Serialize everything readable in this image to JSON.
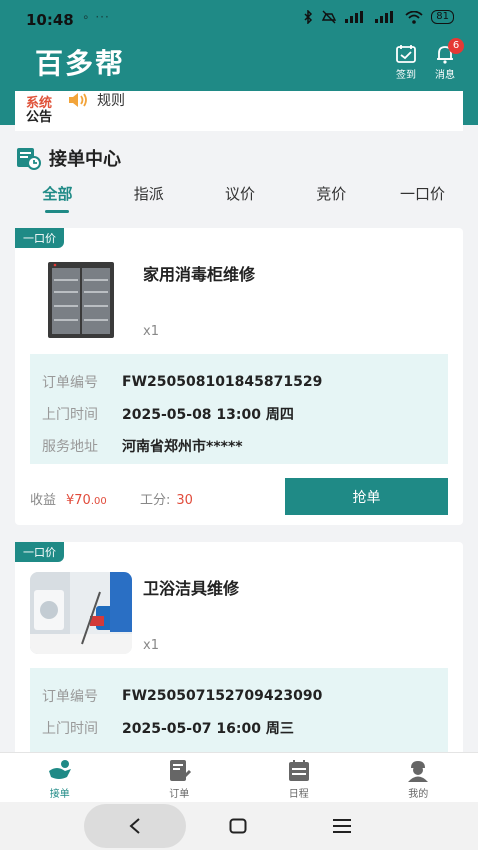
{
  "status_bar": {
    "time": "10:48",
    "extras": "∘ ···",
    "battery": "81"
  },
  "header": {
    "brand": "百多帮",
    "signin_label": "签到",
    "message_label": "消息",
    "message_badge": "6"
  },
  "notice": {
    "label_top": "系统",
    "label_bottom": "公告",
    "text": "规则"
  },
  "section": {
    "title": "接单中心"
  },
  "tabs": [
    "全部",
    "指派",
    "议价",
    "竞价",
    "一口价"
  ],
  "orders": [
    {
      "tag": "一口价",
      "title": "家用消毒柜维修",
      "qty": "x1",
      "order_no_label": "订单编号",
      "order_no": "FW250508101845871529",
      "time_label": "上门时间",
      "time": "2025-05-08 13:00 周四",
      "addr_label": "服务地址",
      "addr": "河南省郑州市*****",
      "earn_label": "收益",
      "earn_amount": "¥70",
      "earn_cents": ".00",
      "points_label": "工分:",
      "points": "30",
      "button": "抢单"
    },
    {
      "tag": "一口价",
      "title": "卫浴洁具维修",
      "qty": "x1",
      "order_no_label": "订单编号",
      "order_no": "FW250507152709423090",
      "time_label": "上门时间",
      "time": "2025-05-07 16:00 周三"
    }
  ],
  "bottom_nav": [
    {
      "label": "接单",
      "active": true
    },
    {
      "label": "订单",
      "active": false
    },
    {
      "label": "日程",
      "active": false
    },
    {
      "label": "我的",
      "active": false
    }
  ],
  "colors": {
    "primary": "#1f8a86",
    "price": "#e14c3c",
    "info_bg": "#e6f5f5"
  }
}
